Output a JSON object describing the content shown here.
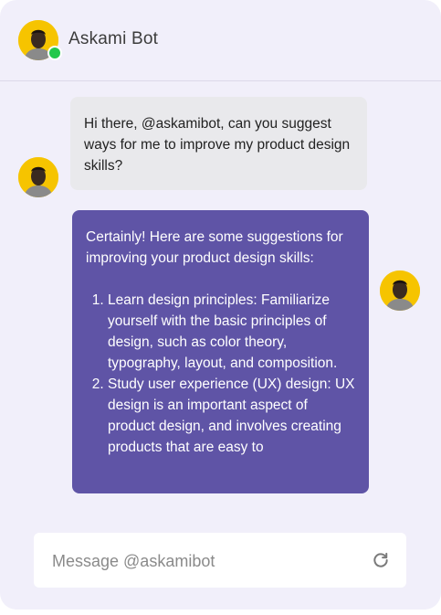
{
  "header": {
    "title": "Askami Bot",
    "avatar_icon": "person-avatar-icon",
    "status": "online",
    "status_color": "#22c84a"
  },
  "messages": [
    {
      "sender": "user",
      "text": "Hi there, @askamibot, can you suggest ways for me to improve my product design skills?"
    },
    {
      "sender": "bot",
      "intro": "Certainly! Here are some suggestions for improving your product design skills:",
      "items": [
        "Learn design principles: Familiarize yourself with the basic principles of design, such as color theory, typography, layout, and composition.",
        "Study user experience (UX) design: UX design is an important aspect of product design, and involves creating products that are easy to"
      ]
    }
  ],
  "composer": {
    "placeholder": "Message @askamibot",
    "value": "",
    "refresh_icon": "refresh-icon"
  },
  "colors": {
    "panel_bg": "#f1effa",
    "user_bubble": "#e9e9ec",
    "bot_bubble": "#5f54a6",
    "avatar_bg": "#f6c400"
  }
}
